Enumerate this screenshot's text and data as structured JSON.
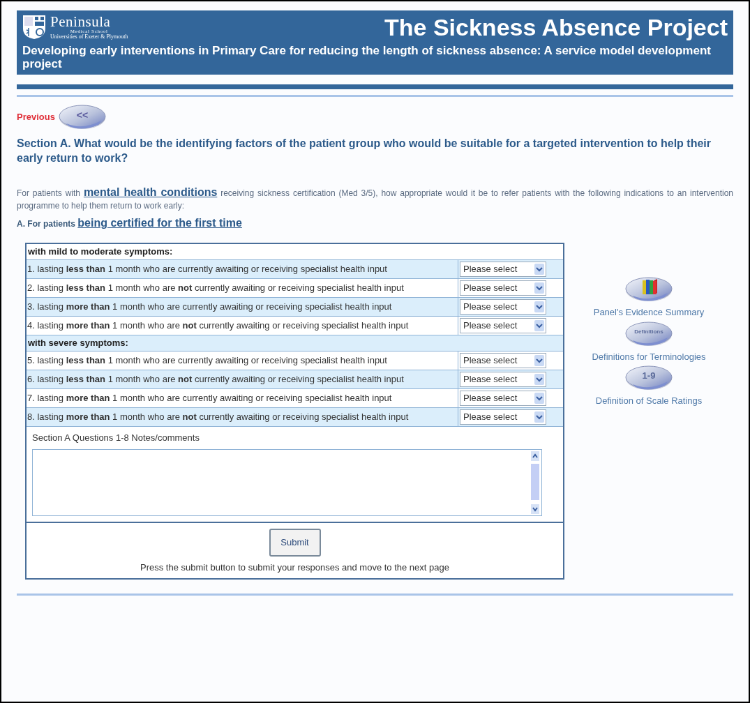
{
  "header": {
    "logo": {
      "name": "Peninsula",
      "subtitle": "Medical School",
      "tagline": "Universities of Exeter & Plymouth"
    },
    "title": "The Sickness Absence Project",
    "subtitle": "Developing early interventions in Primary Care for reducing the length of sickness absence: A service model development project"
  },
  "previous": {
    "label": "Previous",
    "button": "<<"
  },
  "section_title": "Section A. What would be the identifying factors of the patient group who would be suitable for a targeted intervention to help their early return to work?",
  "intro": "For patients with **mental health conditions** receiving sickness certification (Med 3/5), how appropriate would it be to refer patients with the following indications to an intervention programme to help them return to work early:",
  "subheading": "A. For patients **being certified for the first time**",
  "table": {
    "rows": [
      {
        "kind": "group",
        "label": "with mild to moderate symptoms:"
      },
      {
        "kind": "question",
        "label": "1. lasting **less than** 1 month who are currently awaiting or receiving specialist health input",
        "value": "Please select"
      },
      {
        "kind": "question",
        "label": "2. lasting **less than** 1 month who are **not** currently awaiting or receiving specialist health input",
        "value": "Please select"
      },
      {
        "kind": "question",
        "label": "3. lasting **more than** 1 month who are currently awaiting or receiving specialist health input",
        "value": "Please select"
      },
      {
        "kind": "question",
        "label": "4. lasting **more than** 1 month who are **not** currently awaiting or receiving specialist health input",
        "value": "Please select"
      },
      {
        "kind": "group",
        "label": "with severe symptoms:"
      },
      {
        "kind": "question",
        "label": "5. lasting **less than** 1 month who are currently awaiting or receiving specialist health input",
        "value": "Please select"
      },
      {
        "kind": "question",
        "label": "6. lasting **less than** 1 month who are **not** currently awaiting or receiving specialist health input",
        "value": "Please select"
      },
      {
        "kind": "question",
        "label": "7. lasting **more than** 1 month who are currently awaiting or receiving specialist health input",
        "value": "Please select"
      },
      {
        "kind": "question",
        "label": "8. lasting **more than** 1 month who are **not** currently awaiting or receiving specialist health input",
        "value": "Please select"
      }
    ],
    "notes_label": "Section A Questions 1-8 Notes/comments",
    "submit": "Submit",
    "submit_hint": "Press the submit button to submit your responses and move to the next page"
  },
  "side_links": [
    {
      "kind": "books",
      "label": "Panel's Evidence Summary"
    },
    {
      "kind": "text",
      "button": "Definitions",
      "label": "Definitions for Terminologies"
    },
    {
      "kind": "text",
      "button": "1-9",
      "label": "Definition of Scale Ratings"
    }
  ]
}
